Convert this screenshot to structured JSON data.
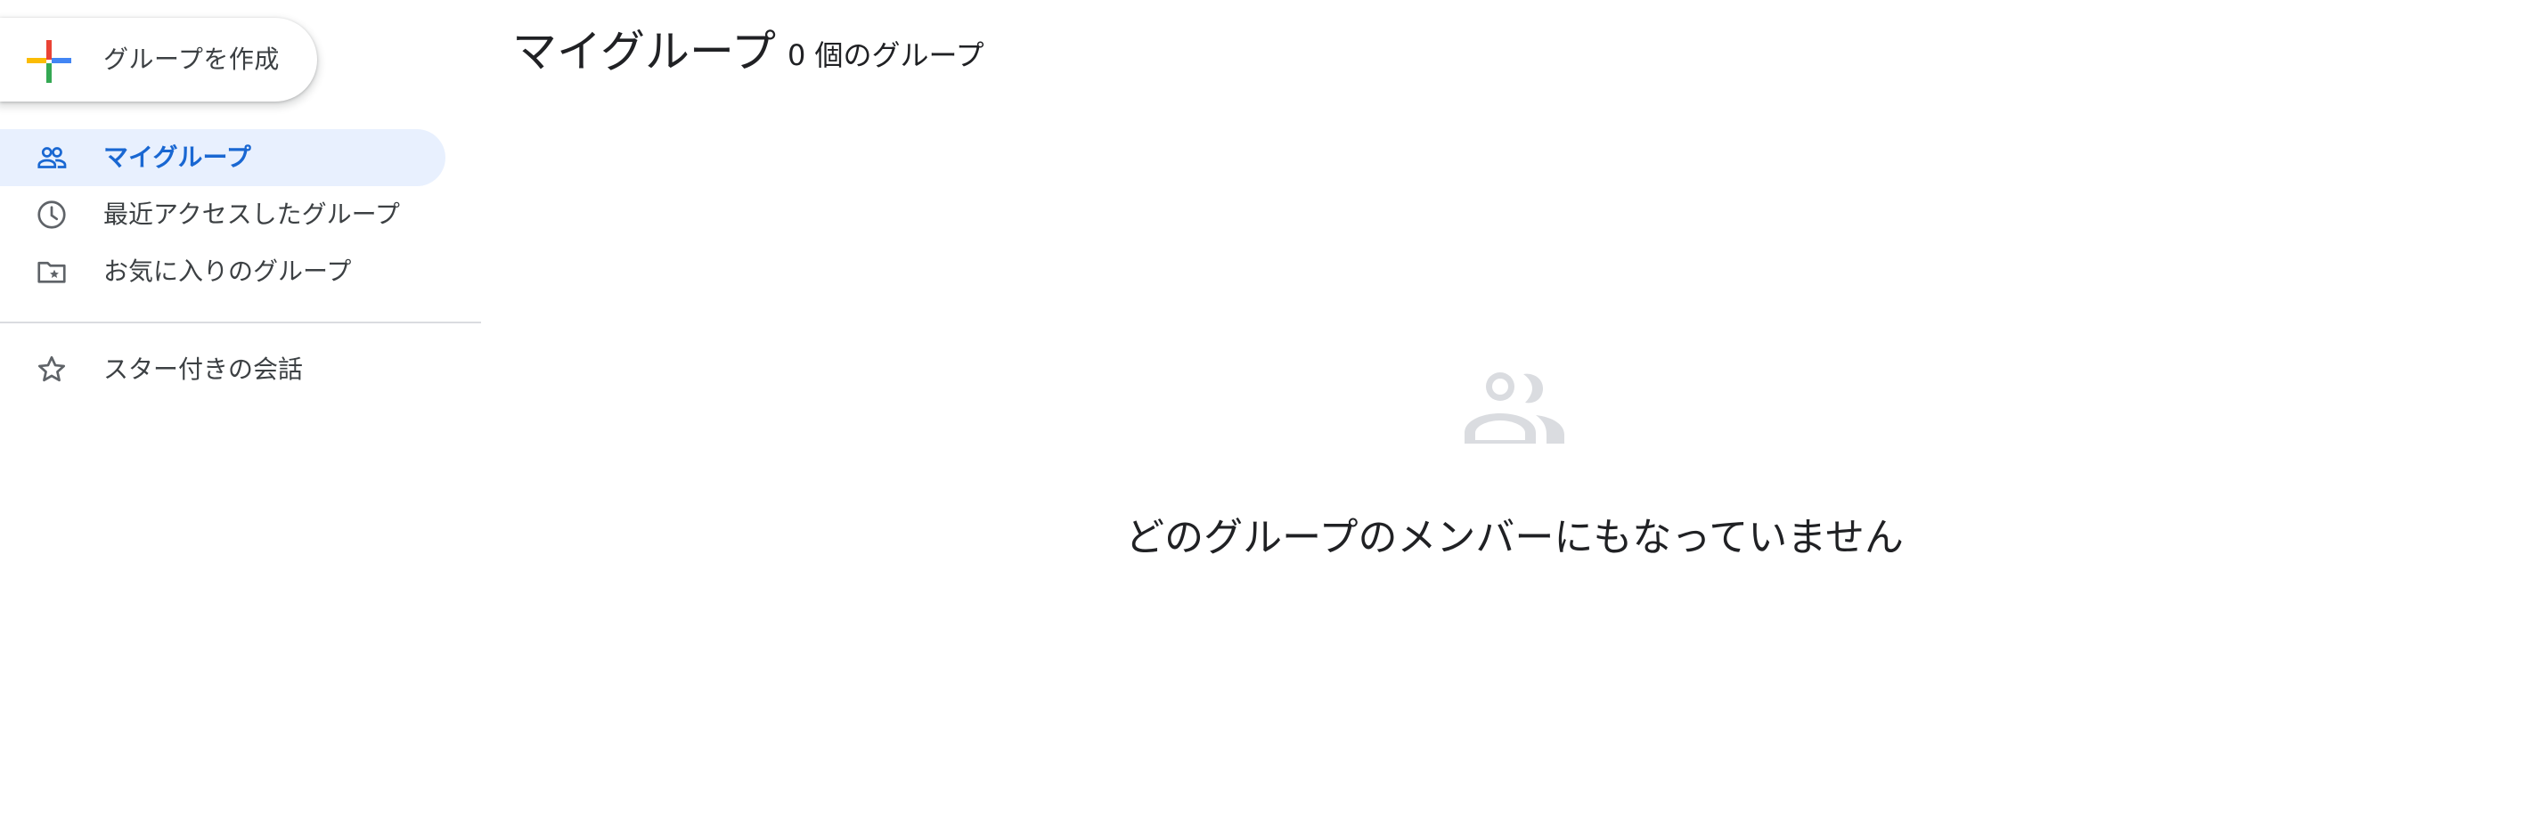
{
  "create_button": {
    "label": "グループを作成",
    "icon": "colored-plus-icon",
    "colors": [
      "#ea4335",
      "#4285f4",
      "#34a853",
      "#fbbc04"
    ]
  },
  "sidebar": {
    "items": [
      {
        "label": "マイグループ",
        "icon": "people-icon",
        "selected": true
      },
      {
        "label": "最近アクセスしたグループ",
        "icon": "clock-icon",
        "selected": false
      },
      {
        "label": "お気に入りのグループ",
        "icon": "folder-star-icon",
        "selected": false
      }
    ],
    "secondary_items": [
      {
        "label": "スター付きの会話",
        "icon": "star-icon",
        "selected": false
      }
    ]
  },
  "header": {
    "title": "マイグループ",
    "count": "0 個のグループ"
  },
  "empty_state": {
    "icon": "people-icon",
    "message": "どのグループのメンバーにもなっていません"
  },
  "colors": {
    "selected_bg": "#e8f0fe",
    "selected_text": "#1967d2",
    "text": "#202124",
    "secondary_text": "#3c4043",
    "icon": "#5f6368",
    "empty_icon": "#dadce0",
    "divider": "#dadce0"
  }
}
